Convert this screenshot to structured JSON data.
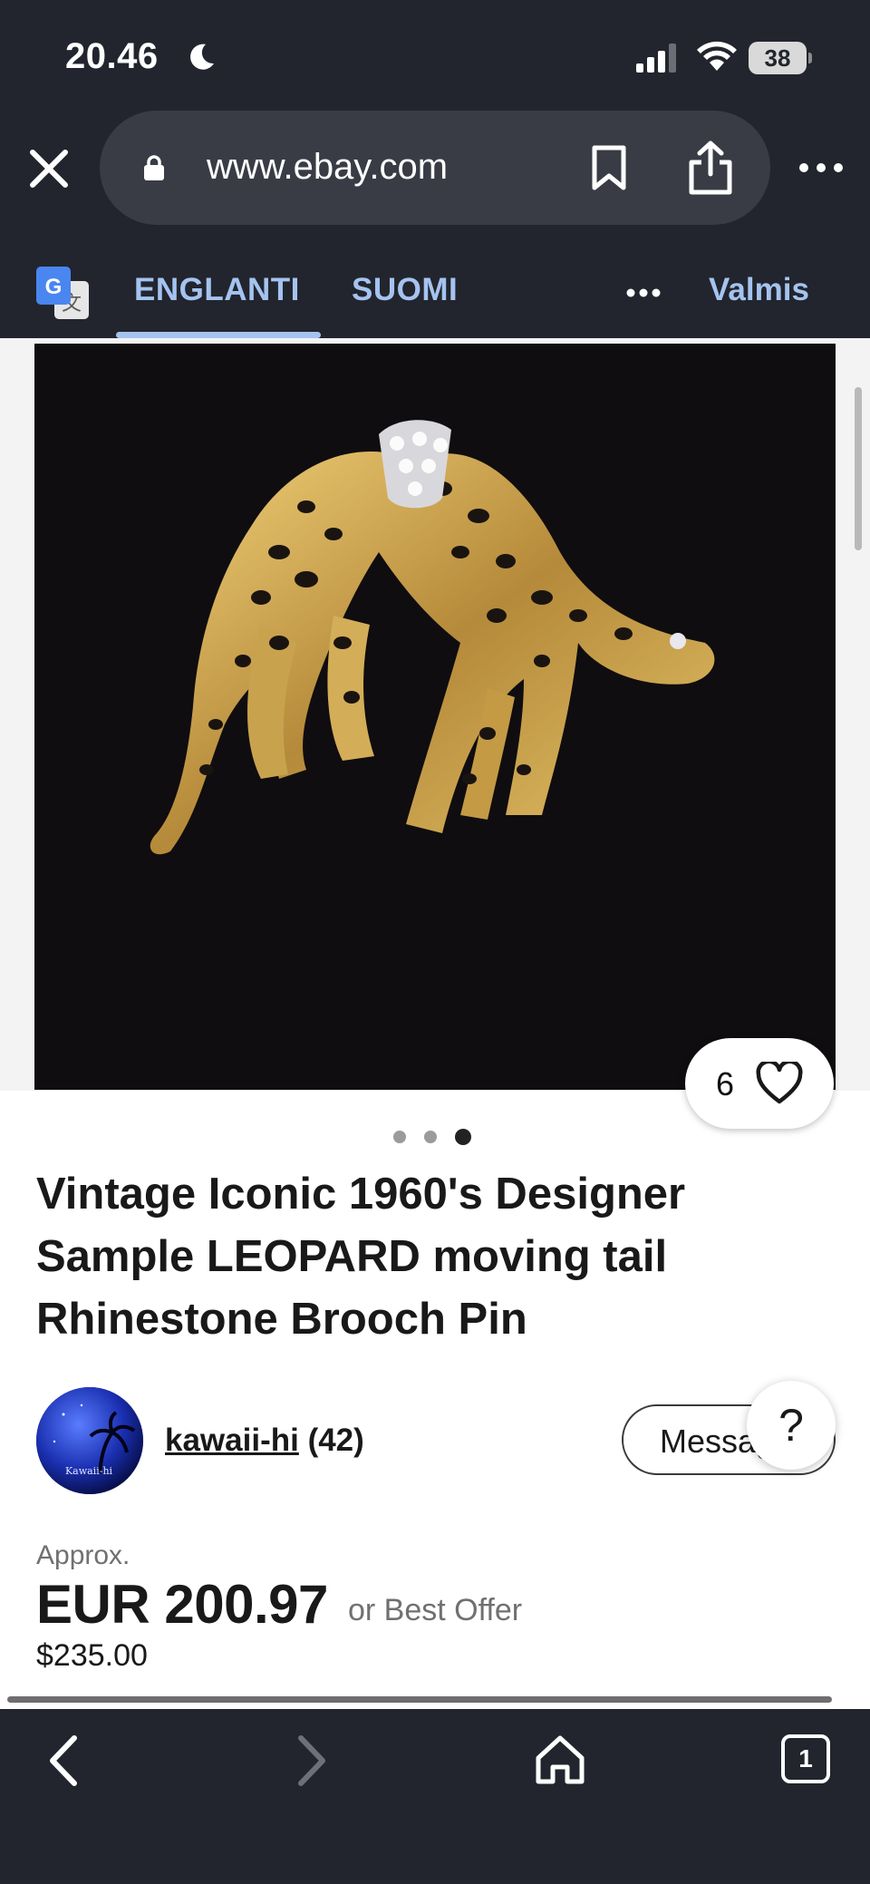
{
  "status_bar": {
    "time": "20.46",
    "battery": "38"
  },
  "browser": {
    "url": "www.ebay.com",
    "tab_count": "1"
  },
  "translate_bar": {
    "source_language": "ENGLANTI",
    "target_language": "SUOMI",
    "done_label": "Valmis"
  },
  "listing": {
    "image_description_icon": "leopard-brooch-photo",
    "image_count": 3,
    "active_image_index": 3,
    "watch_count": "6",
    "title": "Vintage Iconic 1960's Designer Sample LEOPARD moving tail Rhinestone Brooch Pin",
    "seller": {
      "name": "kawaii-hi",
      "feedback": "(42)",
      "avatar_text": "Kawaii-hi"
    },
    "message_label": "Message",
    "help_label": "?",
    "price": {
      "approx_label": "Approx.",
      "converted": "EUR 200.97",
      "offer": "or Best Offer",
      "original": "$235.00"
    }
  },
  "colors": {
    "chrome_bg": "#22252d",
    "urlbar_bg": "#393c45",
    "translate_accent": "#a5c3f0",
    "text_primary": "#191919",
    "text_secondary": "#707070"
  }
}
